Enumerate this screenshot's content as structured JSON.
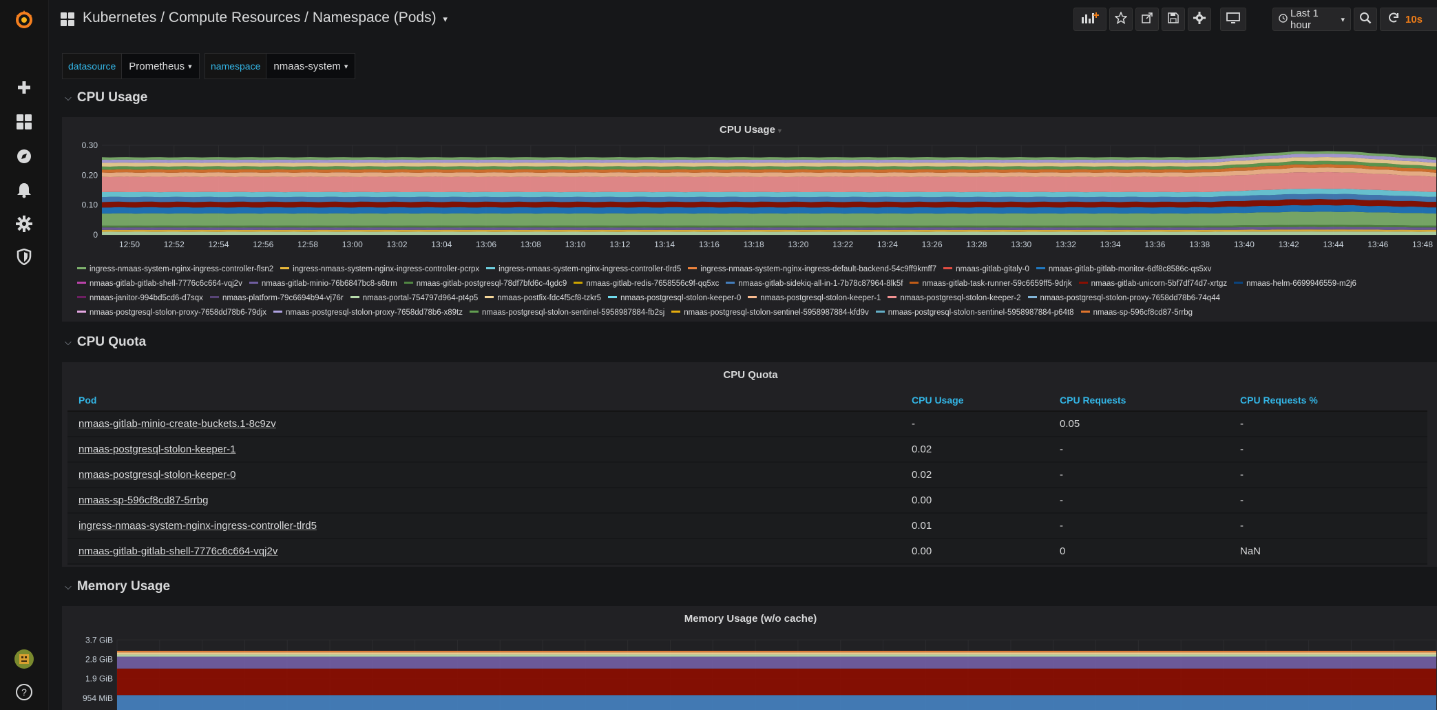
{
  "topbar": {
    "breadcrumb": "Kubernetes / Compute Resources / Namespace (Pods)",
    "time_range": "Last 1 hour",
    "refresh_rate": "10s"
  },
  "variables": [
    {
      "label": "datasource",
      "value": "Prometheus"
    },
    {
      "label": "namespace",
      "value": "nmaas-system"
    }
  ],
  "rows": {
    "cpu_usage": "CPU Usage",
    "cpu_quota": "CPU Quota",
    "memory_usage": "Memory Usage"
  },
  "cpu_panel": {
    "title": "CPU Usage"
  },
  "quota_panel": {
    "title": "CPU Quota",
    "columns": [
      "Pod",
      "CPU Usage",
      "CPU Requests",
      "CPU Requests %"
    ],
    "rows": [
      [
        "nmaas-gitlab-minio-create-buckets.1-8c9zv",
        "-",
        "0.05",
        "-"
      ],
      [
        "nmaas-postgresql-stolon-keeper-1",
        "0.02",
        "-",
        "-"
      ],
      [
        "nmaas-postgresql-stolon-keeper-0",
        "0.02",
        "-",
        "-"
      ],
      [
        "nmaas-sp-596cf8cd87-5rrbg",
        "0.00",
        "-",
        "-"
      ],
      [
        "ingress-nmaas-system-nginx-ingress-controller-tlrd5",
        "0.01",
        "-",
        "-"
      ],
      [
        "nmaas-gitlab-gitlab-shell-7776c6c664-vqj2v",
        "0.00",
        "0",
        "NaN"
      ]
    ]
  },
  "memory_panel": {
    "title": "Memory Usage (w/o cache)"
  },
  "chart_data": [
    {
      "type": "area",
      "title": "CPU Usage",
      "stacked": true,
      "x": [
        "12:50",
        "12:52",
        "12:54",
        "12:56",
        "12:58",
        "13:00",
        "13:02",
        "13:04",
        "13:06",
        "13:08",
        "13:10",
        "13:12",
        "13:14",
        "13:16",
        "13:18",
        "13:20",
        "13:22",
        "13:24",
        "13:26",
        "13:28",
        "13:30",
        "13:32",
        "13:34",
        "13:36",
        "13:38",
        "13:40",
        "13:42",
        "13:44",
        "13:46",
        "13:48"
      ],
      "y_ticks": [
        "0",
        "0.10",
        "0.20",
        "0.30"
      ],
      "ylim": [
        0,
        0.3
      ],
      "total_approx": [
        0.26,
        0.26,
        0.26,
        0.26,
        0.26,
        0.26,
        0.26,
        0.26,
        0.26,
        0.26,
        0.26,
        0.26,
        0.26,
        0.26,
        0.26,
        0.26,
        0.26,
        0.26,
        0.26,
        0.26,
        0.26,
        0.26,
        0.26,
        0.26,
        0.26,
        0.27,
        0.28,
        0.28,
        0.27,
        0.26
      ],
      "legend_rows": [
        [
          {
            "name": "ingress-nmaas-system-nginx-ingress-controller-flsn2",
            "color": "#7eb26d"
          },
          {
            "name": "ingress-nmaas-system-nginx-ingress-controller-pcrpx",
            "color": "#eab839"
          },
          {
            "name": "ingress-nmaas-system-nginx-ingress-controller-tlrd5",
            "color": "#6ed0e0"
          },
          {
            "name": "ingress-nmaas-system-nginx-ingress-default-backend-54c9ff9kmff7",
            "color": "#ef843c"
          },
          {
            "name": "nmaas-gitlab-gitaly-0",
            "color": "#e24d42"
          },
          {
            "name": "nmaas-gitlab-gitlab-monitor-6df8c8586c-qs5xv",
            "color": "#1f78c1"
          }
        ],
        [
          {
            "name": "nmaas-gitlab-gitlab-shell-7776c6c664-vqj2v",
            "color": "#ba43a9"
          },
          {
            "name": "nmaas-gitlab-minio-76b6847bc8-s6trm",
            "color": "#705da0"
          },
          {
            "name": "nmaas-gitlab-postgresql-78df7bfd6c-4gdc9",
            "color": "#508642"
          },
          {
            "name": "nmaas-gitlab-redis-7658556c9f-qq5xc",
            "color": "#cca300"
          },
          {
            "name": "nmaas-gitlab-sidekiq-all-in-1-7b78c87964-8lk5f",
            "color": "#447ebc"
          },
          {
            "name": "nmaas-gitlab-task-runner-59c6659ff5-9drjk",
            "color": "#c15c17"
          },
          {
            "name": "nmaas-gitlab-unicorn-5bf7df74d7-xrtgz",
            "color": "#890f02"
          },
          {
            "name": "nmaas-helm-6699946559-m2j6",
            "color": "#0a437c"
          }
        ],
        [
          {
            "name": "nmaas-janitor-994bd5cd6-d7sqx",
            "color": "#6d1f62"
          },
          {
            "name": "nmaas-platform-79c6694b94-vj76r",
            "color": "#584477"
          },
          {
            "name": "nmaas-portal-754797d964-pt4p5",
            "color": "#b7dbab"
          },
          {
            "name": "nmaas-postfix-fdc4f5cf8-tzkr5",
            "color": "#f4d598"
          },
          {
            "name": "nmaas-postgresql-stolon-keeper-0",
            "color": "#70dbed"
          },
          {
            "name": "nmaas-postgresql-stolon-keeper-1",
            "color": "#f9ba8f"
          },
          {
            "name": "nmaas-postgresql-stolon-keeper-2",
            "color": "#f29191"
          },
          {
            "name": "nmaas-postgresql-stolon-proxy-7658dd78b6-74q44",
            "color": "#82b5d8"
          }
        ],
        [
          {
            "name": "nmaas-postgresql-stolon-proxy-7658dd78b6-79djx",
            "color": "#e5a8e2"
          },
          {
            "name": "nmaas-postgresql-stolon-proxy-7658dd78b6-x89tz",
            "color": "#aea2e0"
          },
          {
            "name": "nmaas-postgresql-stolon-sentinel-5958987884-fb2sj",
            "color": "#629e51"
          },
          {
            "name": "nmaas-postgresql-stolon-sentinel-5958987884-kfd9v",
            "color": "#e5ac0e"
          },
          {
            "name": "nmaas-postgresql-stolon-sentinel-5958987884-p64t8",
            "color": "#64b0c8"
          },
          {
            "name": "nmaas-sp-596cf8cd87-5rrbg",
            "color": "#e0752d"
          }
        ]
      ],
      "bands": [
        {
          "color": "#b7dbab",
          "value": 0.01
        },
        {
          "color": "#eab839",
          "value": 0.006
        },
        {
          "color": "#705da0",
          "value": 0.008
        },
        {
          "color": "#508642",
          "value": 0.006
        },
        {
          "color": "#7eb26d",
          "value": 0.04
        },
        {
          "color": "#1f78c1",
          "value": 0.02
        },
        {
          "color": "#890f02",
          "value": 0.018
        },
        {
          "color": "#447ebc",
          "value": 0.016
        },
        {
          "color": "#6ed0e0",
          "value": 0.016
        },
        {
          "color": "#f29191",
          "value": 0.05
        },
        {
          "color": "#f9ba8f",
          "value": 0.014
        },
        {
          "color": "#e0752d",
          "value": 0.01
        },
        {
          "color": "#629e51",
          "value": 0.01
        },
        {
          "color": "#f4d598",
          "value": 0.012
        },
        {
          "color": "#aea2e0",
          "value": 0.01
        },
        {
          "color": "#7eb26d",
          "value": 0.008
        }
      ]
    },
    {
      "type": "area",
      "title": "Memory Usage (w/o cache)",
      "stacked": true,
      "y_ticks": [
        "954 MiB",
        "1.9 GiB",
        "2.8 GiB",
        "3.7 GiB"
      ],
      "bands": [
        {
          "color": "#447ebc",
          "value": 0.85
        },
        {
          "color": "#890f02",
          "value": 1.0
        },
        {
          "color": "#705da0",
          "value": 0.45
        },
        {
          "color": "#b7dbab",
          "value": 0.08
        },
        {
          "color": "#f4d598",
          "value": 0.08
        },
        {
          "color": "#ef843c",
          "value": 0.06
        }
      ]
    }
  ],
  "icons": {
    "logo": "grafana-logo-icon",
    "sidebar": [
      "plus-icon",
      "dashboards-icon",
      "explore-icon",
      "bell-icon",
      "gear-icon",
      "shield-icon",
      "avatar",
      "help-icon"
    ],
    "toolbar": [
      "add-panel-icon",
      "star-icon",
      "share-icon",
      "save-icon",
      "settings-icon",
      "tv-icon",
      "clock-icon",
      "zoom-out-icon",
      "refresh-icon"
    ]
  }
}
